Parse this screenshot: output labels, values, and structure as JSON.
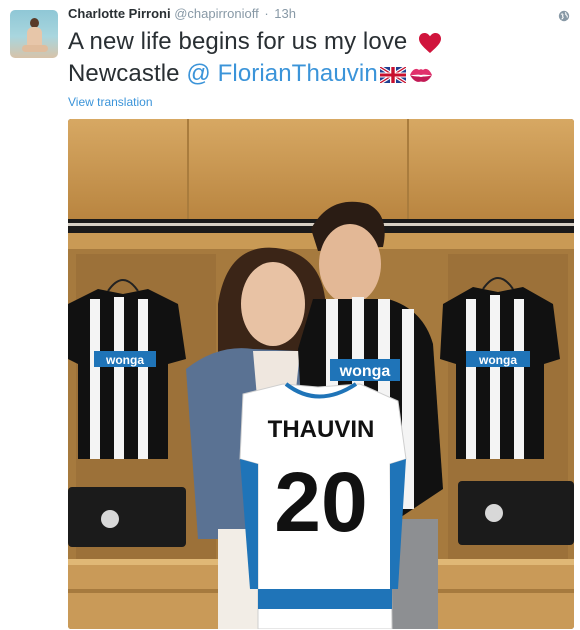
{
  "tweet": {
    "author": {
      "name": "Charlotte Pirroni",
      "handle": "@chapirronioff"
    },
    "separator": "·",
    "time": "13h",
    "text_line1": "A new life begins for us my love",
    "text_line2_prefix": "Newcastle",
    "mention": "@ FlorianThauvin",
    "translate_link": "View translation"
  },
  "photo": {
    "jersey_name": "THAUVIN",
    "jersey_number": "20",
    "sponsor": "wonga"
  },
  "icons": {
    "globe": "globe-icon",
    "heart": "red-heart-emoji",
    "flag": "uk-flag-emoji",
    "lips": "kiss-mark-emoji"
  },
  "colors": {
    "text": "#292f33",
    "muted": "#8899a6",
    "link": "#3b94d9",
    "heart": "#e0245e"
  }
}
